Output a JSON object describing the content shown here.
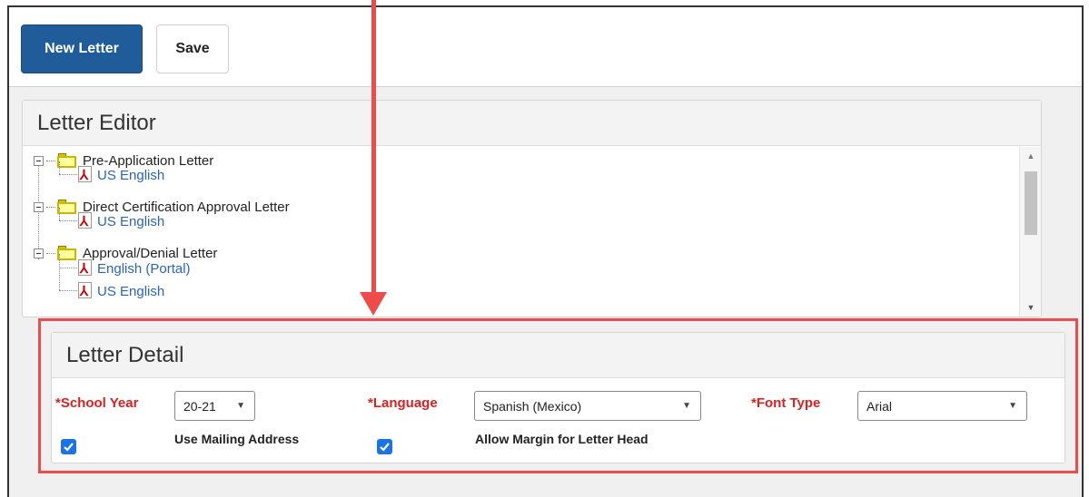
{
  "toolbar": {
    "new_letter_label": "New Letter",
    "save_label": "Save"
  },
  "letter_editor": {
    "title": "Letter Editor",
    "tree": [
      {
        "label": "Pre-Application Letter",
        "children": [
          "US English"
        ]
      },
      {
        "label": "Direct Certification Approval Letter",
        "children": [
          "US English"
        ]
      },
      {
        "label": "Approval/Denial Letter",
        "children": [
          "English (Portal)",
          "US English"
        ]
      }
    ]
  },
  "letter_detail": {
    "title": "Letter Detail",
    "school_year": {
      "label": "*School Year",
      "value": "20-21"
    },
    "language": {
      "label": "*Language",
      "value": "Spanish (Mexico)"
    },
    "font_type": {
      "label": "*Font Type",
      "value": "Arial"
    },
    "use_mailing_address": {
      "label": "Use Mailing Address",
      "checked": true
    },
    "allow_margin": {
      "label": "Allow Margin for Letter Head",
      "checked": true
    }
  },
  "colors": {
    "primary_button": "#1f5c99",
    "required_label": "#e01e1e",
    "annotation": "#ee4b4b",
    "link": "#2a64c0"
  },
  "icons": {
    "expander": "minus-box-icon",
    "folder": "folder-icon",
    "document": "pdf-icon",
    "dropdown": "caret-down-icon",
    "checkbox": "checkmark-icon"
  }
}
